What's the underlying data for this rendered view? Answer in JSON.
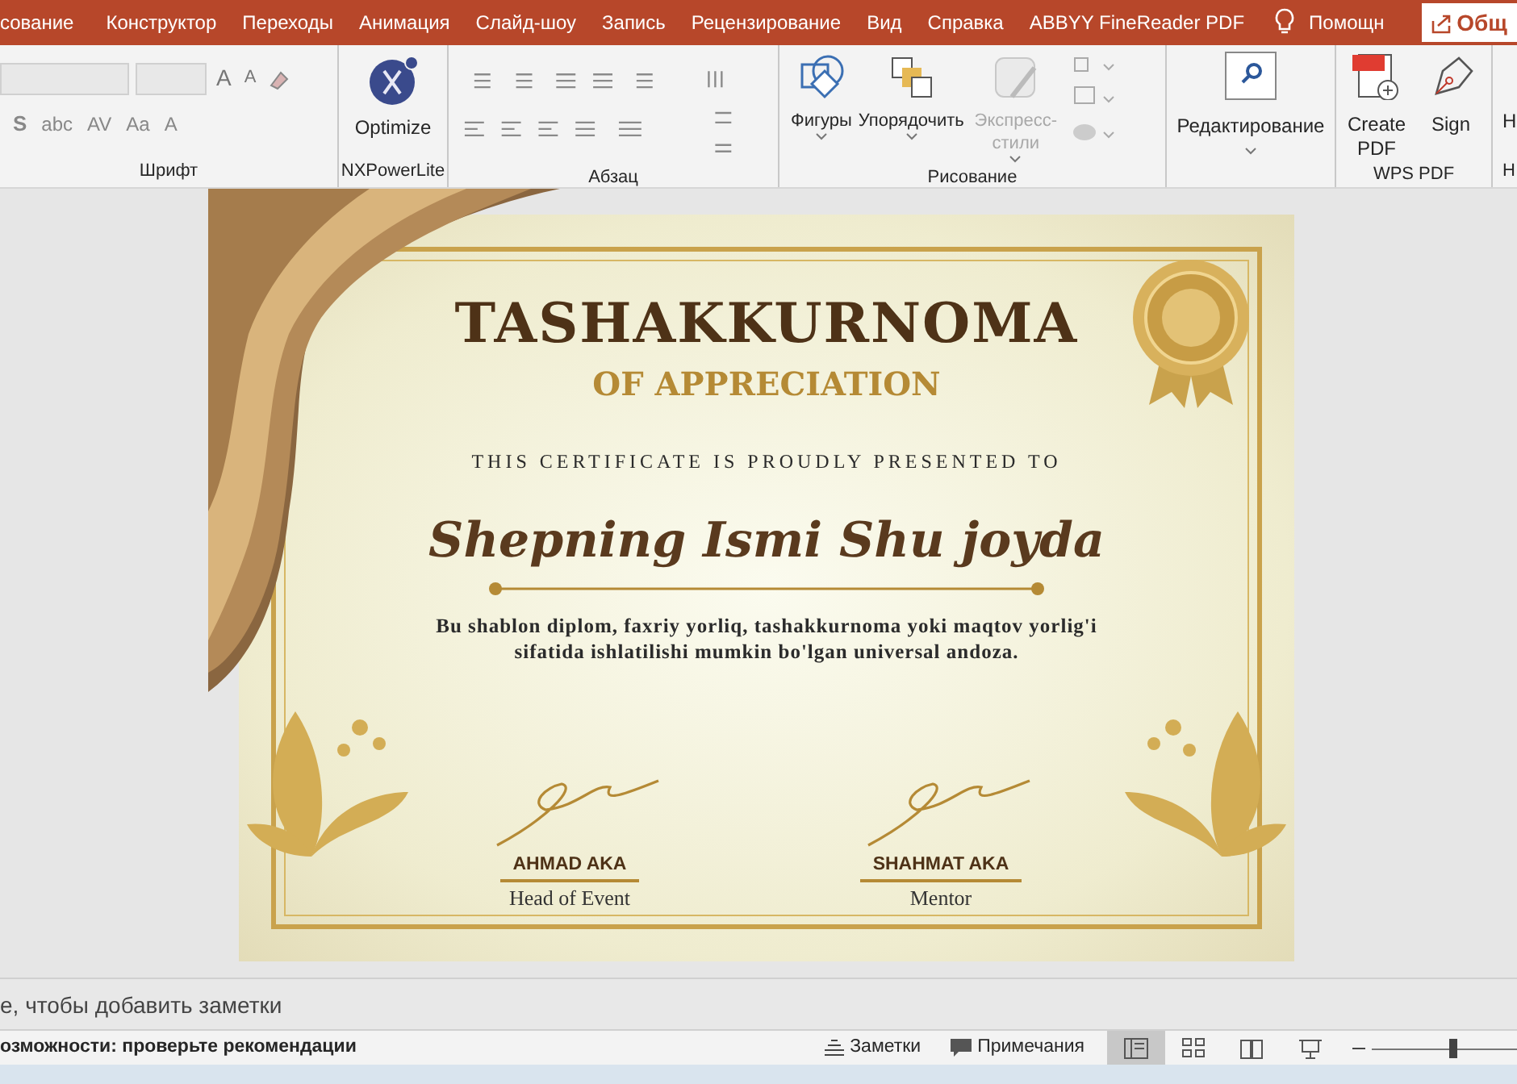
{
  "tabs": [
    {
      "label": "сование"
    },
    {
      "label": "Конструктор"
    },
    {
      "label": "Переходы"
    },
    {
      "label": "Анимация"
    },
    {
      "label": "Слайд-шоу"
    },
    {
      "label": "Запись"
    },
    {
      "label": "Рецензирование"
    },
    {
      "label": "Вид"
    },
    {
      "label": "Справка"
    },
    {
      "label": "ABBYY FineReader PDF"
    }
  ],
  "help_search": "Помощн",
  "share_button": "Общ",
  "ribbon": {
    "font_group": {
      "label": "Шрифт",
      "row1": [
        "A",
        "A"
      ],
      "row2": [
        "S",
        "abc",
        "AV",
        "Aa",
        "A"
      ]
    },
    "nxpowerlite": {
      "label": "NXPowerLite",
      "button": "Optimize"
    },
    "paragraph": {
      "label": "Абзац"
    },
    "drawing": {
      "label": "Рисование",
      "buttons": [
        {
          "kind": "shapes",
          "label": "Фигуры",
          "disabled": false
        },
        {
          "kind": "arrange",
          "label": "Упорядочить",
          "disabled": false
        },
        {
          "kind": "styles",
          "label": "Экспресс-стили",
          "disabled": true
        }
      ]
    },
    "editing": {
      "button": "Редактирование"
    },
    "wps_pdf": {
      "label": "WPS PDF",
      "buttons": [
        {
          "kind": "create",
          "label": "Create PDF"
        },
        {
          "kind": "sign",
          "label": "Sign"
        }
      ]
    },
    "cut_group": {
      "button": "Н",
      "label": "Н"
    }
  },
  "slide": {
    "title": "TASHAKKURNOMA",
    "subtitle": "OF APPRECIATION",
    "presented_to": "THIS CERTIFICATE IS PROUDLY PRESENTED TO",
    "recipient": "Shepning Ismi Shu joyda",
    "description": "Bu shablon diplom, faxriy yorliq, tashakkurnoma yoki maqtov yorlig'i sifatida ishlatilishi mumkin bo'lgan universal andoza.",
    "signatures": [
      {
        "name": "AHMAD AKA",
        "role": "Head of Event"
      },
      {
        "name": "SHAHMAT AKA",
        "role": "Mentor"
      }
    ]
  },
  "notes": {
    "placeholder": "е, чтобы добавить заметки"
  },
  "status_bar": {
    "accessibility": "озможности: проверьте рекомендации",
    "notes_button": "Заметки",
    "comments_button": "Примечания",
    "views": [
      {
        "kind": "normal",
        "selected": true
      },
      {
        "kind": "sorter",
        "selected": false
      },
      {
        "kind": "reading",
        "selected": false
      },
      {
        "kind": "show",
        "selected": false
      }
    ],
    "zoom": {
      "level": 0.55
    }
  }
}
